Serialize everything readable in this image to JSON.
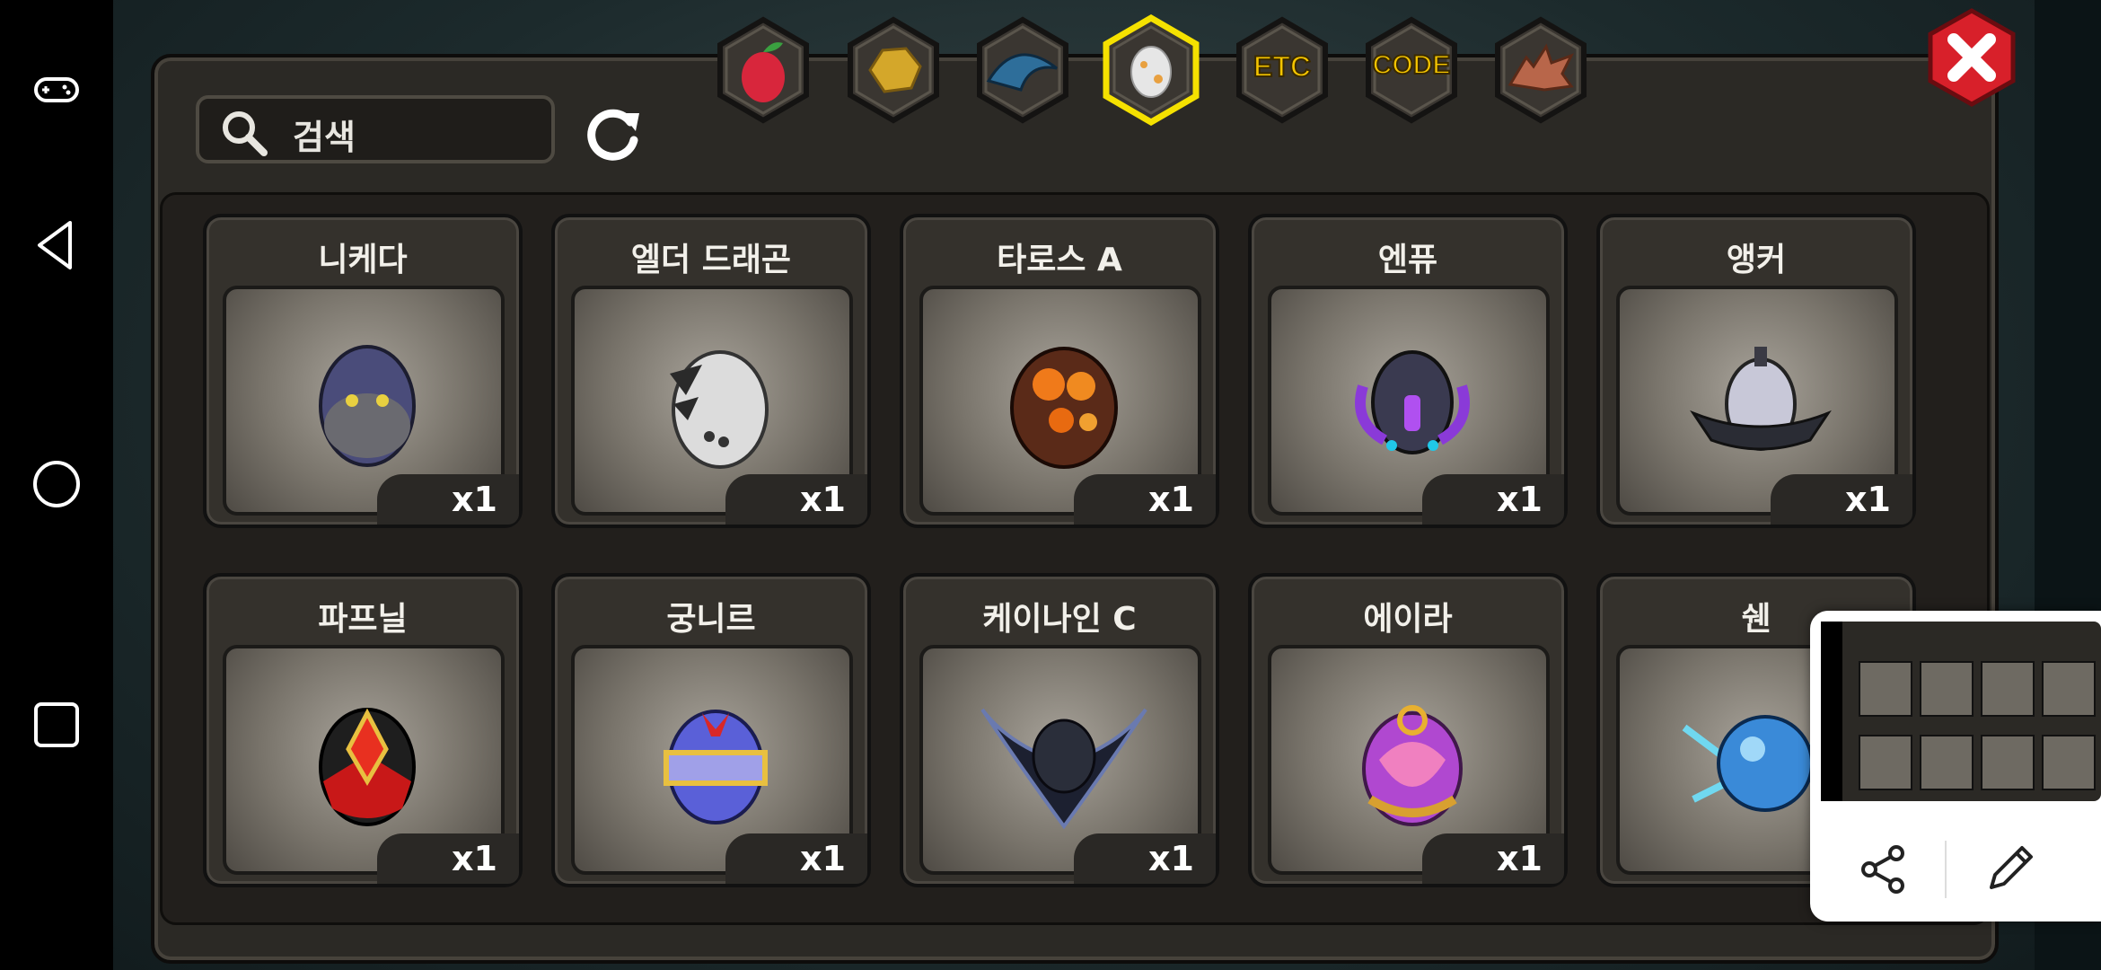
{
  "search": {
    "label": "검색"
  },
  "tabs": [
    {
      "icon": "fruit-icon",
      "text": ""
    },
    {
      "icon": "gold-ore-icon",
      "text": ""
    },
    {
      "icon": "blue-scale-icon",
      "text": ""
    },
    {
      "icon": "egg-icon",
      "text": "",
      "selected": true
    },
    {
      "icon": "etc-icon",
      "text": "ETC"
    },
    {
      "icon": "code-icon",
      "text": "CODE"
    },
    {
      "icon": "dragon-head-icon",
      "text": ""
    }
  ],
  "items": [
    {
      "name": "니케다",
      "qty": "x1",
      "icon": "nikeda-egg-icon"
    },
    {
      "name": "엘더 드래곤",
      "qty": "x1",
      "icon": "elder-dragon-egg-icon"
    },
    {
      "name": "타로스 A",
      "qty": "x1",
      "icon": "taros-a-egg-icon"
    },
    {
      "name": "엔퓨",
      "qty": "x1",
      "icon": "enpyu-egg-icon"
    },
    {
      "name": "앵커",
      "qty": "x1",
      "icon": "anchor-egg-icon"
    },
    {
      "name": "파프닐",
      "qty": "x1",
      "icon": "papnil-egg-icon"
    },
    {
      "name": "궁니르",
      "qty": "x1",
      "icon": "gungnir-egg-icon"
    },
    {
      "name": "케이나인 C",
      "qty": "x1",
      "icon": "canine-c-egg-icon"
    },
    {
      "name": "에이라",
      "qty": "x1",
      "icon": "eira-egg-icon"
    },
    {
      "name": "쉔",
      "qty": "",
      "icon": "shen-egg-icon"
    }
  ],
  "colors": {
    "accent": "#f5e100",
    "panel": "#2b2925",
    "close": "#d8202a"
  }
}
